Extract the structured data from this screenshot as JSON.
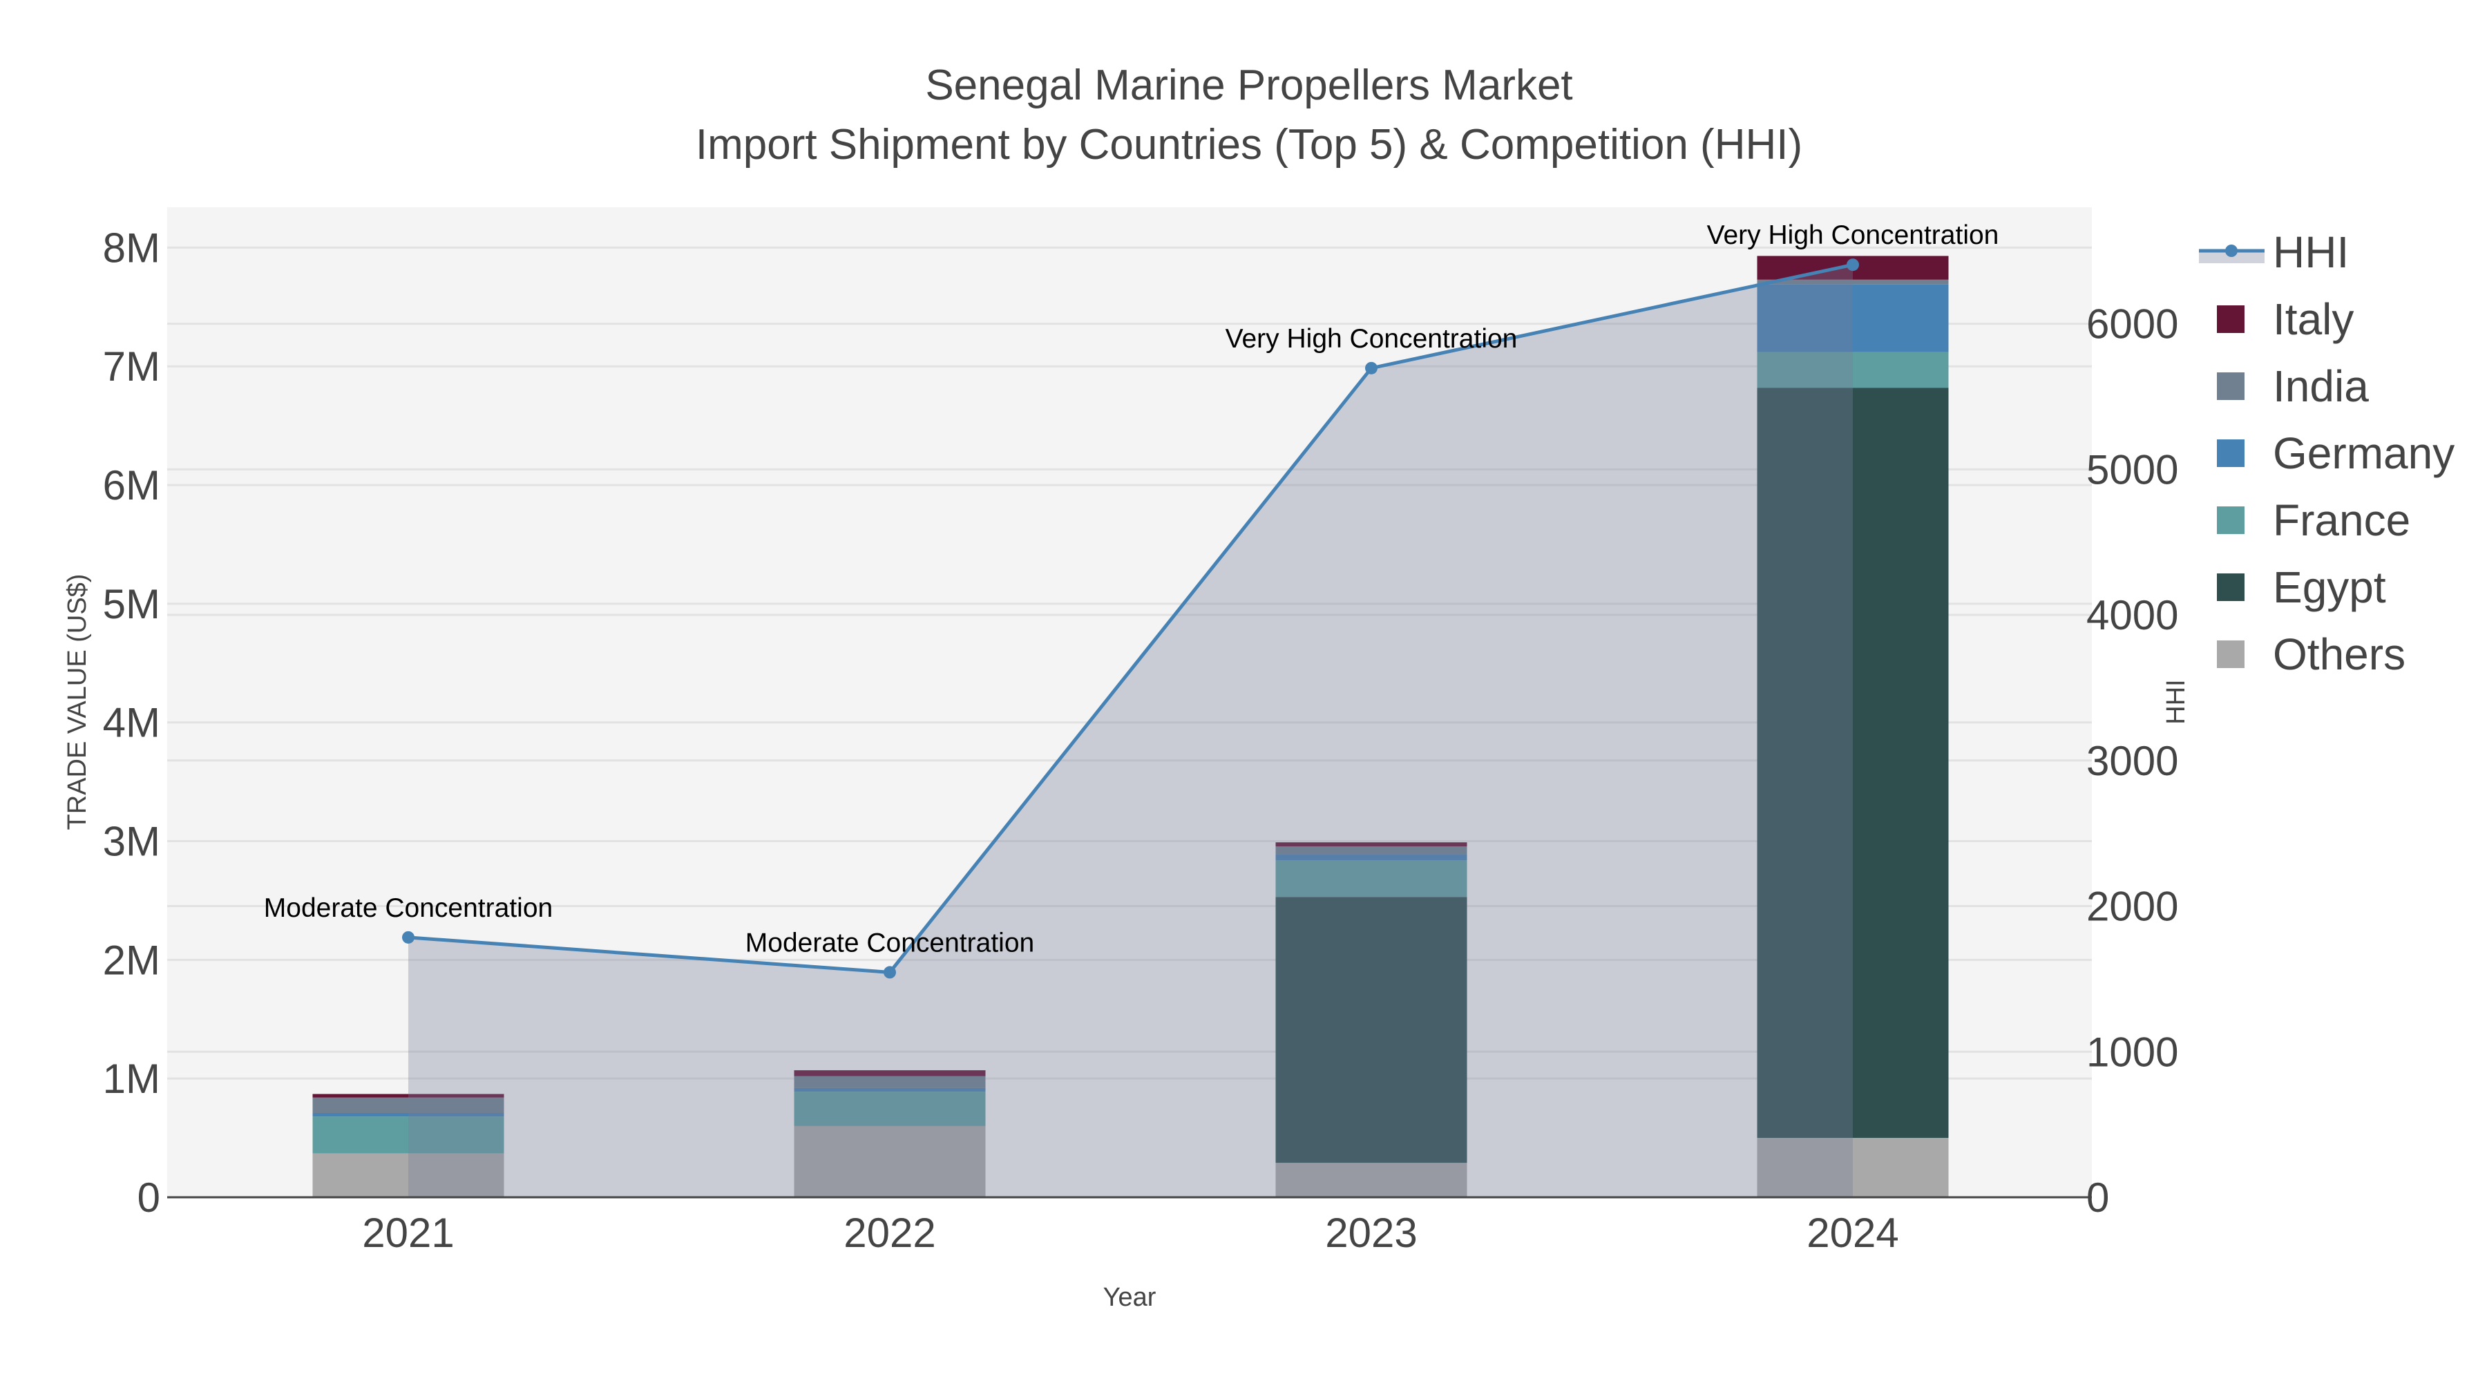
{
  "chart_data": {
    "type": "bar",
    "barmode": "stack",
    "title": "Senegal Marine Propellers Market",
    "subtitle": "Import Shipment by Countries (Top 5) & Competition (HHI)",
    "xlabel": "Year",
    "ylabel": "TRADE VALUE (US$)",
    "y2label": "HHI",
    "categories": [
      "2021",
      "2022",
      "2023",
      "2024"
    ],
    "ylim": [
      0,
      8340000
    ],
    "y2lim": [
      0,
      6800
    ],
    "yticks": [
      0,
      1000000,
      2000000,
      3000000,
      4000000,
      5000000,
      6000000,
      7000000,
      8000000
    ],
    "ytick_labels": [
      "0",
      "1M",
      "2M",
      "3M",
      "4M",
      "5M",
      "6M",
      "7M",
      "8M"
    ],
    "y2ticks": [
      0,
      1000,
      2000,
      3000,
      4000,
      5000,
      6000
    ],
    "y2tick_labels": [
      "0",
      "1000",
      "2000",
      "3000",
      "4000",
      "5000",
      "6000"
    ],
    "grid": true,
    "legend_position": "right",
    "series": [
      {
        "name": "Others",
        "color": "#a9a9a9",
        "values": [
          370000,
          600000,
          290000,
          500000
        ]
      },
      {
        "name": "Egypt",
        "color": "#2f4f4f",
        "values": [
          0,
          0,
          2240000,
          6320000
        ]
      },
      {
        "name": "France",
        "color": "#5f9ea0",
        "values": [
          310000,
          290000,
          310000,
          300000
        ]
      },
      {
        "name": "Germany",
        "color": "#4682b4",
        "values": [
          30000,
          30000,
          50000,
          570000
        ]
      },
      {
        "name": "India",
        "color": "#708090",
        "values": [
          130000,
          100000,
          65000,
          40000
        ]
      },
      {
        "name": "Italy",
        "color": "#641535",
        "values": [
          30000,
          50000,
          35000,
          200000
        ]
      }
    ],
    "hhi": {
      "name": "HHI",
      "color": "#4682b4",
      "values": [
        1785,
        1545,
        5695,
        6405
      ],
      "annotations": [
        "Moderate Concentration",
        "Moderate Concentration",
        "Very High Concentration",
        "Very High Concentration"
      ]
    },
    "legend": [
      "HHI",
      "Italy",
      "India",
      "Germany",
      "France",
      "Egypt",
      "Others"
    ]
  }
}
